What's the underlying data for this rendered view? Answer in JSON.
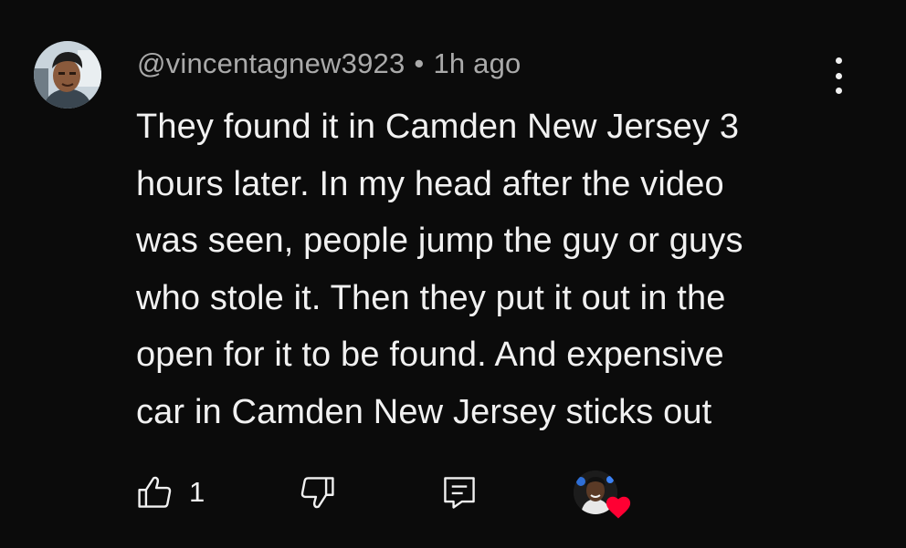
{
  "comment": {
    "author": "@vincentagnew3923",
    "separator": "•",
    "timestamp": "1h ago",
    "text_lines": [
      "They found it in Camden New Jersey 3",
      "hours later. In my head after the video",
      "was seen, people jump the guy or guys",
      "who stole it. Then they put it out in the",
      "open for it to be found. And expensive",
      "car in Camden New Jersey sticks out"
    ]
  },
  "actions": {
    "like_count": "1",
    "like_icon": "thumbs-up-icon",
    "dislike_icon": "thumbs-down-icon",
    "reply_icon": "reply-icon",
    "more_icon": "more-vertical-icon",
    "creator_heart_icon": "heart-icon"
  },
  "colors": {
    "background": "#0b0b0b",
    "text_primary": "#f1f1f1",
    "text_secondary": "#aaaaaa",
    "heart": "#ff0033"
  }
}
